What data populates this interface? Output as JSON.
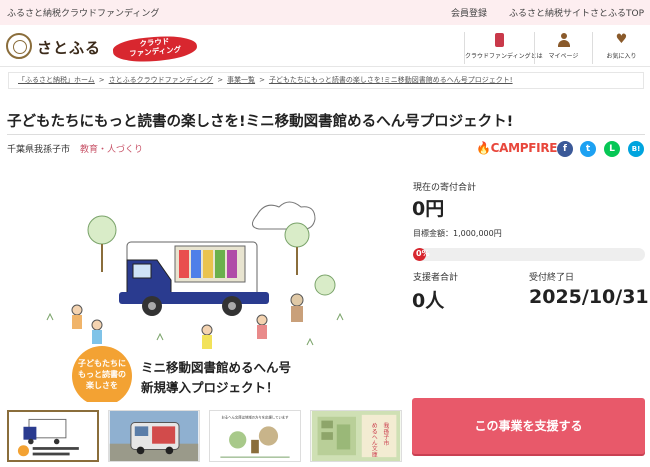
{
  "topbar": {
    "tagline": "ふるさと納税クラウドファンディング",
    "links": [
      "会員登録",
      "ふるさと納税サイトさとふるTOP"
    ]
  },
  "header": {
    "logo_text": "さとふる",
    "badge_line1": "クラウド",
    "badge_line2": "ファンディング",
    "nav": [
      {
        "label": "クラウドファンディングとは",
        "icon": "flag-icon"
      },
      {
        "label": "マイページ",
        "icon": "user-icon"
      },
      {
        "label": "お気に入り",
        "icon": "heart-icon"
      }
    ]
  },
  "breadcrumb": [
    "「ふるさと納税」ホーム",
    "さとふるクラウドファンディング",
    "事業一覧",
    "子どもたちにもっと読書の楽しさを!ミニ移動図書館めるへん号プロジェクト!"
  ],
  "project": {
    "title": "子どもたちにもっと読書の楽しさを!ミニ移動図書館めるへん号プロジェクト!",
    "place": "千葉県我孫子市",
    "category": "教育・人づくり",
    "platform": "CAMPFIRE",
    "share": [
      "f",
      "t",
      "L",
      "B!"
    ],
    "hero_text": {
      "bubble": [
        "子どもたちに",
        "もっと読書の",
        "楽しさを"
      ],
      "headline1": "ミニ移動図書館めるへん号",
      "headline2": "新規導入プロジェクト！"
    },
    "thumb_caption": "おるへん文庫は地域の方々を応援しています",
    "thumb_vertical": [
      "我孫子市",
      "めるへん文庫"
    ]
  },
  "stats": {
    "current_label": "現在の寄付合計",
    "current_value": "0円",
    "goal_label": "目標金額：1,000,000円",
    "progress_text": "0%",
    "progress_fraction": 0,
    "supporters_label": "支援者合計",
    "supporters_value": "0人",
    "deadline_label": "受付終了日",
    "deadline_value": "2025/10/31"
  },
  "cta": {
    "label": "この事業を支援する"
  },
  "colors": {
    "topbar_bg": "#fdeef0",
    "accent": "#d8272f",
    "cta": "#e8596a",
    "category": "#c9576b"
  }
}
